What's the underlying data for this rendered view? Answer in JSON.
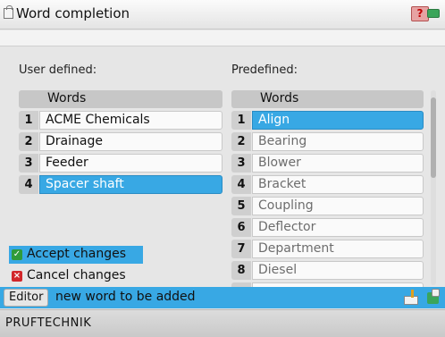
{
  "title": "Word completion",
  "title_icons": [
    "clipboard-icon",
    "help-icon",
    "battery-icon"
  ],
  "colors": {
    "selection": "#38a8e4",
    "accept_icon": "#2f9b3a",
    "cancel_icon": "#d2262a",
    "battery": "#3ba55a"
  },
  "user_defined": {
    "label": "User defined:",
    "header": "Words",
    "rows": [
      {
        "num": "1",
        "text": "ACME Chemicals"
      },
      {
        "num": "2",
        "text": "Drainage"
      },
      {
        "num": "3",
        "text": "Feeder"
      },
      {
        "num": "4",
        "text": "Spacer shaft",
        "selected": true
      }
    ]
  },
  "predefined": {
    "label": "Predefined:",
    "header": "Words",
    "rows": [
      {
        "num": "1",
        "text": "Align",
        "selected": true
      },
      {
        "num": "2",
        "text": "Bearing"
      },
      {
        "num": "3",
        "text": "Blower"
      },
      {
        "num": "4",
        "text": "Bracket"
      },
      {
        "num": "5",
        "text": "Coupling"
      },
      {
        "num": "6",
        "text": "Deflector"
      },
      {
        "num": "7",
        "text": "Department"
      },
      {
        "num": "8",
        "text": "Diesel"
      }
    ]
  },
  "actions": {
    "accept": "Accept changes",
    "cancel": "Cancel changes"
  },
  "editor": {
    "label": "Editor",
    "value": "new word to be added"
  },
  "footer": "PRUFTECHNIK"
}
